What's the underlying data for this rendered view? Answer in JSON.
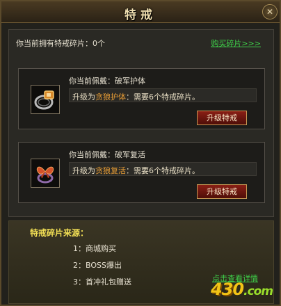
{
  "window": {
    "title": "特戒",
    "close_icon": "close-icon"
  },
  "shards": {
    "owned_label": "你当前拥有特戒碎片：0个",
    "buy_link": "购买碎片>>>"
  },
  "cards": [
    {
      "wearing": "你当前佩戴：破军护体",
      "upgrade_prefix": "升级为",
      "upgrade_item": "贪狼护体",
      "upgrade_suffix": "：需要6个特戒碎片。",
      "button": "升级特戒",
      "icon": "ring-icon"
    },
    {
      "wearing": "你当前佩戴：破军复活",
      "upgrade_prefix": "升级为",
      "upgrade_item": "贪狼复活",
      "upgrade_suffix": "：需要6个特戒碎片。",
      "button": "升级特戒",
      "icon": "butterfly-ring-icon"
    }
  ],
  "sources": {
    "title": "特戒碎片来源：",
    "items": [
      "1：商城购买",
      "2：BOSS爆出",
      "3：首冲礼包赠送"
    ],
    "view_details": "点击查看详情"
  },
  "watermark": {
    "part1": "43",
    "part2": "0",
    "part3": ".com"
  },
  "colors": {
    "accent_green": "#3fd24a",
    "item_orange": "#e39a35",
    "title_yellow": "#f3e055",
    "button_red": "#8a1f15"
  }
}
